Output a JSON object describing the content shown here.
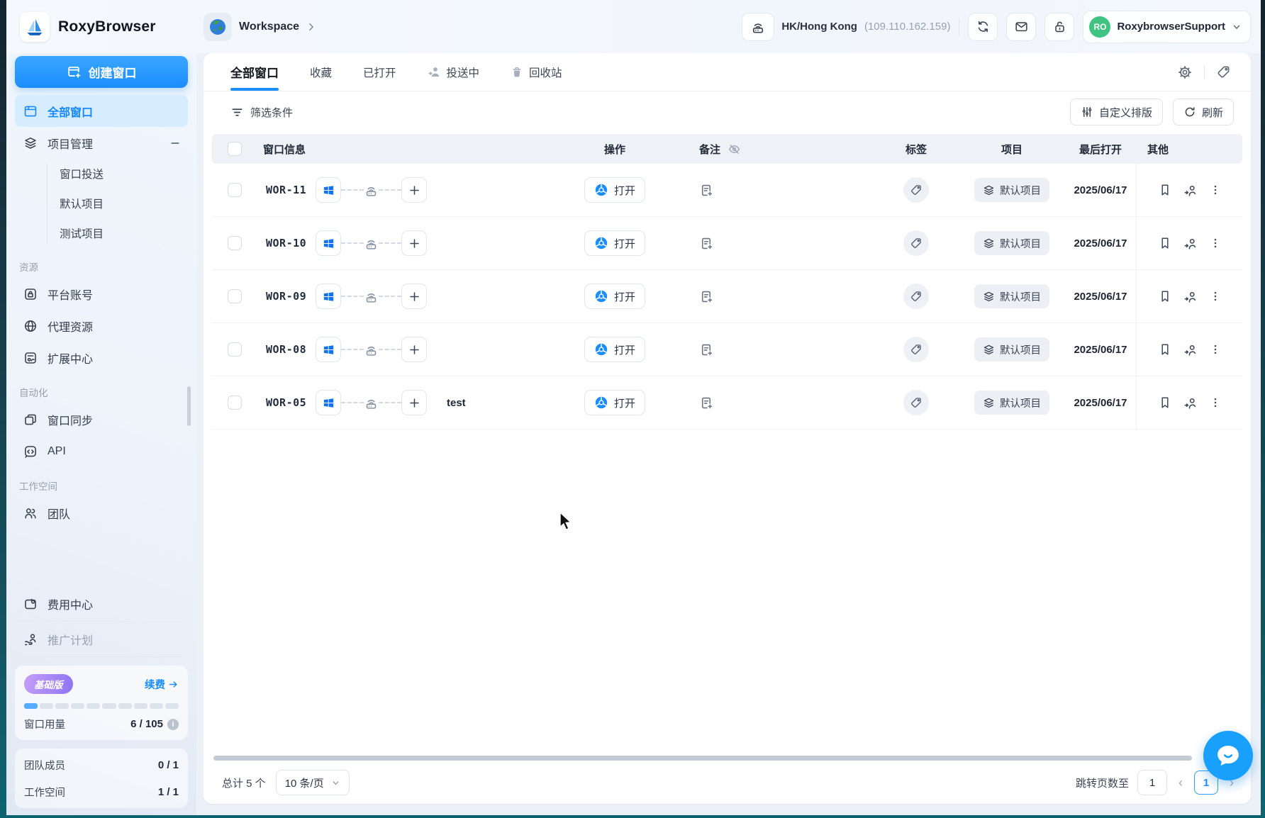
{
  "colors": {
    "accent": "#1b8dfd",
    "avatar_green": "#3fc380",
    "badge_gradient": [
      "#c59ef9",
      "#8d74f2"
    ],
    "chat_blue": "#19a0fd",
    "windows_blue": "#1273eb"
  },
  "app": {
    "name": "RoxyBrowser"
  },
  "topbar": {
    "workspace_label": "Workspace",
    "proxy_region": "HK/Hong Kong",
    "proxy_ip": "(109.110.162.159)",
    "account_name": "RoxybrowserSupport",
    "avatar_initials": "RO"
  },
  "sidebar": {
    "create_window": "创建窗口",
    "nav": {
      "all_windows": "全部窗口",
      "project_mgmt": "项目管理",
      "window_send": "窗口投送",
      "default_project": "默认项目",
      "test_project": "测试项目",
      "platform_accounts": "平台账号",
      "proxy_resources": "代理资源",
      "extension_center": "扩展中心",
      "window_sync": "窗口同步",
      "api": "API",
      "team": "团队",
      "billing_center": "费用中心",
      "referral_plan": "推广计划"
    },
    "sections": {
      "resources": "资源",
      "automation": "自动化",
      "workspace": "工作空间"
    },
    "plan": {
      "badge": "基础版",
      "renew": "续费",
      "usage_label": "窗口用量",
      "usage_value": "6 / 105",
      "progress_total": 10,
      "progress_filled": 1
    },
    "stats": [
      {
        "label": "团队成员",
        "value": "0 / 1"
      },
      {
        "label": "工作空间",
        "value": "1 / 1"
      }
    ]
  },
  "tabs": [
    {
      "label": "全部窗口"
    },
    {
      "label": "收藏"
    },
    {
      "label": "已打开"
    },
    {
      "label": "投送中"
    },
    {
      "label": "回收站"
    }
  ],
  "toolbar": {
    "filter": "筛选条件",
    "custom_layout": "自定义排版",
    "refresh": "刷新"
  },
  "table": {
    "headers": {
      "window_info": "窗口信息",
      "action": "操作",
      "remark": "备注",
      "tag": "标签",
      "project": "项目",
      "last_open": "最后打开",
      "other": "其他"
    },
    "open_label": "打开",
    "rows": [
      {
        "id": "WOR-11",
        "name": "",
        "project": "默认项目",
        "last_open": "2025/06/17"
      },
      {
        "id": "WOR-10",
        "name": "",
        "project": "默认项目",
        "last_open": "2025/06/17"
      },
      {
        "id": "WOR-09",
        "name": "",
        "project": "默认项目",
        "last_open": "2025/06/17"
      },
      {
        "id": "WOR-08",
        "name": "",
        "project": "默认项目",
        "last_open": "2025/06/17"
      },
      {
        "id": "WOR-05",
        "name": "test",
        "project": "默认项目",
        "last_open": "2025/06/17"
      }
    ]
  },
  "footer": {
    "total": "总计 5 个",
    "page_size": "10 条/页",
    "jump_label": "跳转页数至",
    "jump_value": "1",
    "current_page": "1"
  }
}
